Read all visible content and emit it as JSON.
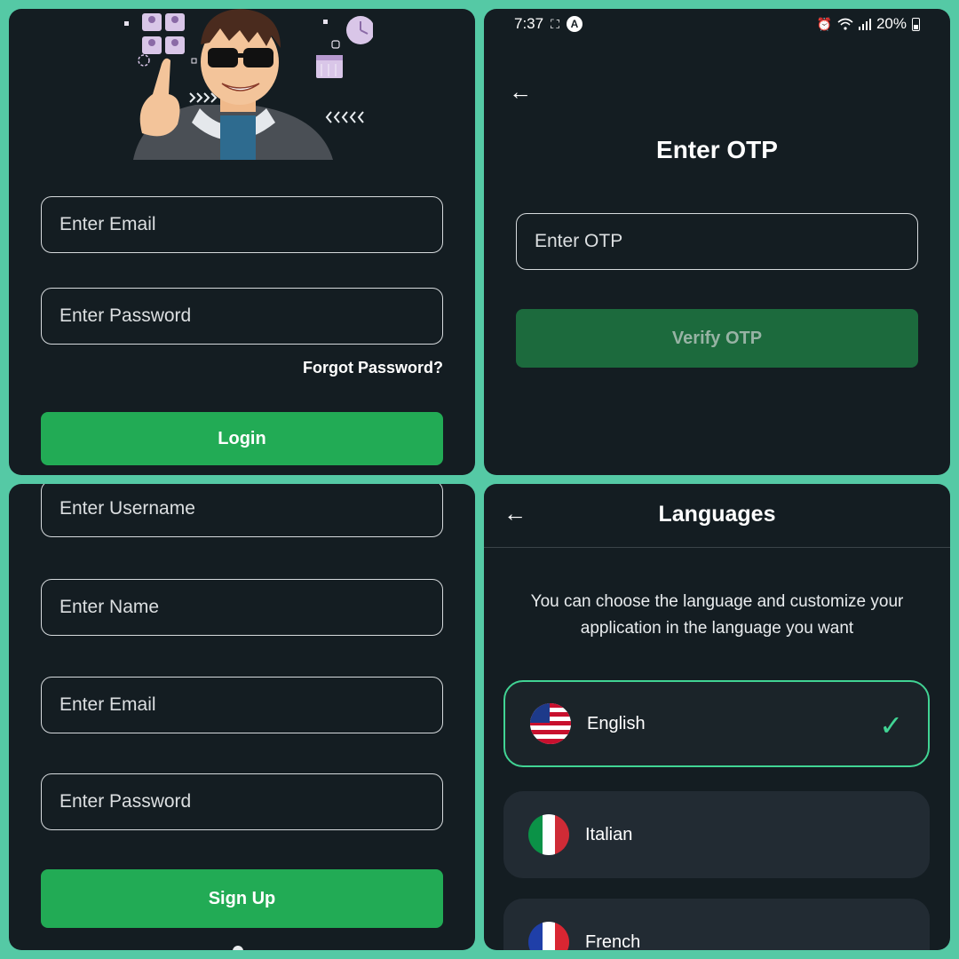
{
  "login": {
    "email_placeholder": "Enter Email",
    "password_placeholder": "Enter Password",
    "forgot_password": "Forgot Password?",
    "login_button": "Login",
    "login_button_color": "#22ab55"
  },
  "otp": {
    "status_time": "7:37",
    "status_app_badge": "A",
    "status_battery": "20%",
    "title": "Enter OTP",
    "otp_placeholder": "Enter OTP",
    "verify_button": "Verify OTP",
    "verify_button_color": "#1c6a3d",
    "verify_text_color": "#97b3a4"
  },
  "signup": {
    "username_placeholder": "Enter Username",
    "name_placeholder": "Enter Name",
    "email_placeholder": "Enter Email",
    "password_placeholder": "Enter Password",
    "signup_button": "Sign Up",
    "signup_button_color": "#22ab55"
  },
  "languages": {
    "title": "Languages",
    "description": "You can choose the language and customize your application in the language you want",
    "items": [
      {
        "label": "English",
        "selected": true,
        "flag": "us-flag-icon"
      },
      {
        "label": "Italian",
        "selected": false,
        "flag": "italy-flag-icon"
      },
      {
        "label": "French",
        "selected": false,
        "flag": "france-flag-icon"
      }
    ],
    "accent_color": "#41d494"
  },
  "icons": {
    "back": "arrow-left-icon",
    "check": "check-icon",
    "status_alarm": "alarm-icon",
    "status_wifi": "wifi-icon",
    "status_signal": "signal-icon",
    "status_battery": "battery-icon"
  }
}
